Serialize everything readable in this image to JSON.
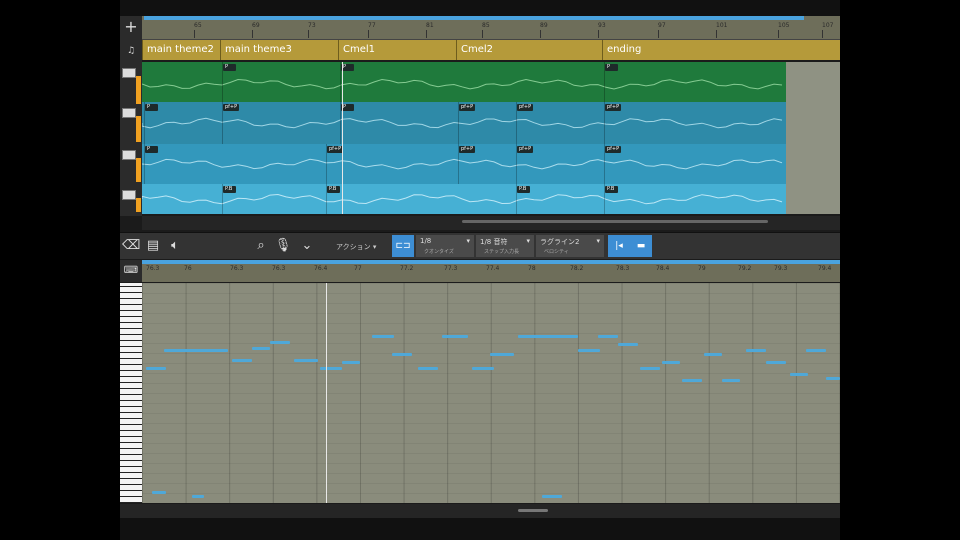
{
  "arrangement": {
    "add_label": "+",
    "ruler_ticks": [
      "65",
      "69",
      "73",
      "77",
      "81",
      "85",
      "89",
      "93",
      "97",
      "101",
      "105",
      "107"
    ],
    "markers": [
      {
        "label": "main theme2",
        "start": 0,
        "end": 78
      },
      {
        "label": "main theme3",
        "start": 78,
        "end": 196
      },
      {
        "label": "Cmel1",
        "start": 196,
        "end": 314
      },
      {
        "label": "Cmel2",
        "start": 314,
        "end": 460
      },
      {
        "label": "ending",
        "start": 460,
        "end": 698
      }
    ],
    "tracks": [
      {
        "color": "#1f7a3c",
        "line": "#9fe0a8",
        "tags": [
          {
            "at": 80,
            "label": "P"
          },
          {
            "at": 198,
            "label": "P"
          },
          {
            "at": 462,
            "label": "P"
          }
        ]
      },
      {
        "color": "#2e8aa8",
        "line": "#bde8f4",
        "tags": [
          {
            "at": 2,
            "label": "P"
          },
          {
            "at": 80,
            "label": "pf+P"
          },
          {
            "at": 198,
            "label": "P"
          },
          {
            "at": 316,
            "label": "pf+P"
          },
          {
            "at": 374,
            "label": "pf+P"
          },
          {
            "at": 462,
            "label": "pf+P"
          }
        ]
      },
      {
        "color": "#3398bc",
        "line": "#c8eef8",
        "tags": [
          {
            "at": 2,
            "label": "P"
          },
          {
            "at": 184,
            "label": "pf+P"
          },
          {
            "at": 316,
            "label": "pf+P"
          },
          {
            "at": 374,
            "label": "pf+P"
          },
          {
            "at": 462,
            "label": "pf+P"
          }
        ]
      },
      {
        "color": "#46b0d4",
        "line": "#d8f4fc",
        "tags": [
          {
            "at": 80,
            "label": "P.B"
          },
          {
            "at": 184,
            "label": "P.B"
          },
          {
            "at": 374,
            "label": "P.B"
          },
          {
            "at": 462,
            "label": "P.B"
          }
        ]
      }
    ]
  },
  "toolbar": {
    "action_label": "アクション",
    "quantize": {
      "value": "1/8",
      "caption": "クオンタイズ"
    },
    "length": {
      "value": "1/8 音符",
      "caption": "ステップ入力長"
    },
    "velocity": {
      "value": "ラグライン2",
      "caption": "ベロシティ"
    }
  },
  "piano_roll": {
    "ruler_ticks": [
      "76.3",
      "76",
      "76.3",
      "76.3",
      "76.4",
      "77",
      "77.2",
      "77.3",
      "77.4",
      "78",
      "78.2",
      "78.3",
      "78.4",
      "79",
      "79.2",
      "79.3",
      "79.4"
    ],
    "notes": [
      [
        4,
        84,
        20
      ],
      [
        22,
        66,
        64
      ],
      [
        90,
        76,
        20
      ],
      [
        110,
        64,
        18
      ],
      [
        128,
        58,
        20
      ],
      [
        152,
        76,
        24
      ],
      [
        178,
        84,
        22
      ],
      [
        200,
        78,
        18
      ],
      [
        230,
        52,
        22
      ],
      [
        250,
        70,
        20
      ],
      [
        276,
        84,
        20
      ],
      [
        300,
        52,
        26
      ],
      [
        330,
        84,
        22
      ],
      [
        348,
        70,
        24
      ],
      [
        376,
        52,
        60
      ],
      [
        436,
        66,
        22
      ],
      [
        456,
        52,
        20
      ],
      [
        476,
        60,
        20
      ],
      [
        498,
        84,
        20
      ],
      [
        520,
        78,
        18
      ],
      [
        540,
        96,
        20
      ],
      [
        562,
        70,
        18
      ],
      [
        580,
        96,
        18
      ],
      [
        604,
        66,
        20
      ],
      [
        624,
        78,
        20
      ],
      [
        648,
        90,
        18
      ],
      [
        664,
        66,
        20
      ],
      [
        684,
        94,
        14
      ],
      [
        10,
        208,
        14
      ],
      [
        50,
        212,
        12
      ],
      [
        400,
        212,
        20
      ]
    ]
  }
}
